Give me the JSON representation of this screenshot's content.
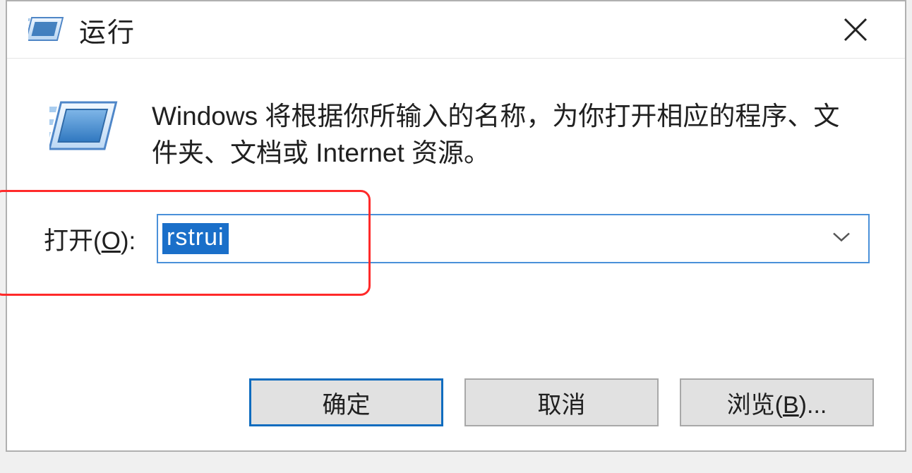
{
  "title": "运行",
  "description": "Windows 将根据你所输入的名称，为你打开相应的程序、文件夹、文档或 Internet 资源。",
  "open_label_prefix": "打开(",
  "open_label_hotkey": "O",
  "open_label_suffix": "):",
  "input_value": "rstrui",
  "buttons": {
    "ok": "确定",
    "cancel": "取消",
    "browse_prefix": "浏览(",
    "browse_hotkey": "B",
    "browse_suffix": ")..."
  }
}
